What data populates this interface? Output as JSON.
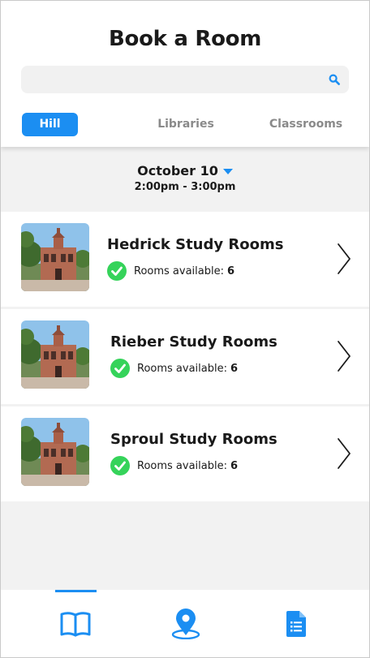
{
  "header": {
    "title": "Book a Room",
    "search": {
      "placeholder": "",
      "value": "",
      "icon": "search-icon"
    }
  },
  "tabs": [
    {
      "label": "Hill",
      "active": true
    },
    {
      "label": "Libraries",
      "active": false
    },
    {
      "label": "Classrooms",
      "active": false
    }
  ],
  "date_picker": {
    "date": "October 10",
    "time_range": "2:00pm - 3:00pm",
    "icon": "caret-down-icon"
  },
  "rooms": [
    {
      "name": "Hedrick Study Rooms",
      "available_label": "Rooms available:",
      "available_count": "6"
    },
    {
      "name": "Rieber Study Rooms",
      "available_label": "Rooms available:",
      "available_count": "6"
    },
    {
      "name": "Sproul Study Rooms",
      "available_label": "Rooms available:",
      "available_count": "6"
    }
  ],
  "bottom_nav": [
    {
      "icon": "book-icon",
      "active": true
    },
    {
      "icon": "map-pin-icon",
      "active": false
    },
    {
      "icon": "document-icon",
      "active": false
    }
  ],
  "colors": {
    "accent": "#1b8ef2",
    "success": "#35d35a",
    "background": "#f2f2f2"
  }
}
